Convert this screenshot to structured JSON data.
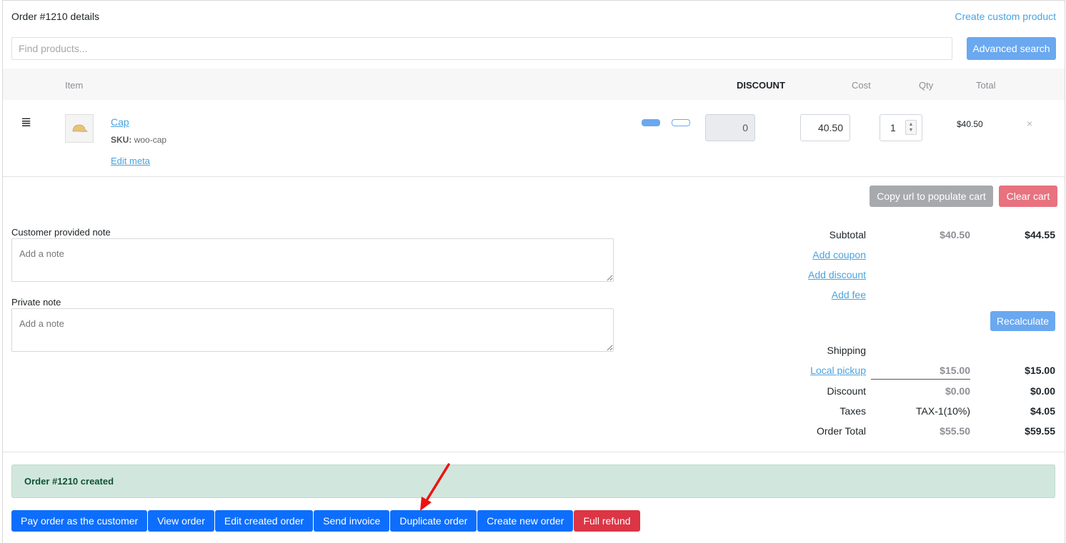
{
  "header": {
    "title": "Order #1210 details",
    "create_custom_product": "Create custom product"
  },
  "search": {
    "placeholder": "Find products...",
    "advanced_label": "Advanced search"
  },
  "table": {
    "columns": {
      "item": "Item",
      "discount": "DISCOUNT",
      "cost": "Cost",
      "qty": "Qty",
      "total": "Total"
    },
    "rows": [
      {
        "name": "Cap",
        "sku_label": "SKU:",
        "sku": "woo-cap",
        "edit_meta": "Edit meta",
        "discount": "0",
        "cost": "40.50",
        "qty": "1",
        "total": "$40.50",
        "remove": "×"
      }
    ]
  },
  "cart_actions": {
    "copy_url": "Copy url to populate cart",
    "clear": "Clear cart"
  },
  "notes": {
    "customer_label": "Customer provided note",
    "customer_placeholder": "Add a note",
    "private_label": "Private note",
    "private_placeholder": "Add a note"
  },
  "totals": {
    "subtotal_label": "Subtotal",
    "subtotal_orig": "$40.50",
    "subtotal_new": "$44.55",
    "add_coupon": "Add coupon",
    "add_discount": "Add discount",
    "add_fee": "Add fee",
    "recalculate": "Recalculate",
    "shipping_label": "Shipping",
    "shipping_method": "Local pickup",
    "shipping_orig": "$15.00",
    "shipping_new": "$15.00",
    "discount_label": "Discount",
    "discount_orig": "$0.00",
    "discount_new": "$0.00",
    "taxes_label": "Taxes",
    "taxes_orig": "TAX-1(10%)",
    "taxes_new": "$4.05",
    "order_total_label": "Order Total",
    "order_total_orig": "$55.50",
    "order_total_new": "$59.55"
  },
  "notice": {
    "text": "Order #1210 created"
  },
  "bottom_buttons": [
    "Pay order as the customer",
    "View order",
    "Edit created order",
    "Send invoice",
    "Duplicate order",
    "Create new order",
    "Full refund"
  ],
  "colors": {
    "link": "#4aa3df",
    "primary": "#0d6efd",
    "primary_light": "#6aa8f0",
    "danger": "#dc3545",
    "annotation_arrow": "#ee1111"
  }
}
